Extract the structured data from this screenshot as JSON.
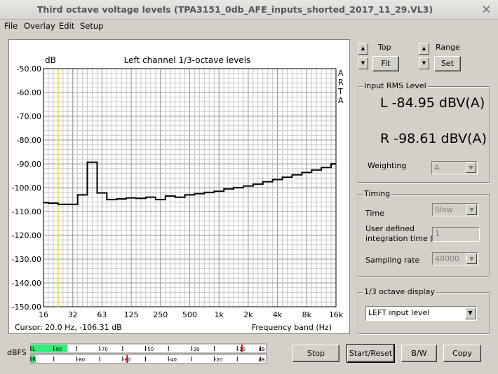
{
  "window": {
    "title": "Third octave voltage levels (TPA3151_0db_AFE_inputs_shorted_2017_11_29.VL3)",
    "close_glyph": "✕"
  },
  "menu": [
    "File",
    "Overlay",
    "Edit",
    "Setup"
  ],
  "chart_data": {
    "type": "line",
    "title": "Left channel 1/3-octave levels",
    "ylabel": "dB",
    "xlabel": "Frequency band (Hz)",
    "side_label": [
      "A",
      "R",
      "T",
      "A"
    ],
    "ylim": [
      -150,
      -50
    ],
    "y_ticks": [
      "-50.00",
      "-60.00",
      "-70.00",
      "-80.00",
      "-90.00",
      "-100.00",
      "-110.00",
      "-120.00",
      "-130.00",
      "-140.00",
      "-150.00"
    ],
    "x_ticks": [
      "16",
      "32",
      "63",
      "125",
      "250",
      "500",
      "1k",
      "2k",
      "4k",
      "8k",
      "16k"
    ],
    "cursor_text": "Cursor:   20.0 Hz, -106.31 dB",
    "series": [
      {
        "color": "#000000",
        "bands": [
          "16",
          "20",
          "25",
          "31.5",
          "40",
          "50",
          "63",
          "80",
          "100",
          "125",
          "160",
          "200",
          "250",
          "315",
          "400",
          "500",
          "630",
          "800",
          "1k",
          "1.25k",
          "1.6k",
          "2k",
          "2.5k",
          "3.15k",
          "4k",
          "5k",
          "6.3k",
          "8k",
          "10k",
          "12.5k",
          "16k"
        ],
        "values": [
          -106.3,
          -106.5,
          -107,
          -107,
          -103,
          -89.3,
          -102.2,
          -105,
          -104.7,
          -104.3,
          -104.5,
          -104,
          -105,
          -103.5,
          -104,
          -103,
          -102.5,
          -102,
          -101.5,
          -100.5,
          -100,
          -99.3,
          -98.5,
          -97.5,
          -96.6,
          -95.6,
          -94.6,
          -93.6,
          -92.6,
          -91.5,
          -90
        ]
      }
    ],
    "cursor_band": "20",
    "cursor_color": "#e6e600"
  },
  "controls": {
    "top_label": "Top",
    "fit_label": "Fit",
    "range_label": "Range",
    "set_label": "Set",
    "up_glyph": "▲",
    "down_glyph": "▼"
  },
  "rms": {
    "group_label": "Input RMS Level",
    "left": "L  -84.95 dBV(A)",
    "right": "R  -98.61 dBV(A)",
    "weighting_label": "Weighting",
    "weighting_value": "A"
  },
  "timing": {
    "group_label": "Timing",
    "time_label": "Time",
    "time_value": "Slow",
    "user_time_label_1": "User defined",
    "user_time_label_2": "integration time (s)",
    "user_time_value": "1",
    "sampling_label": "Sampling rate",
    "sampling_value": "48000"
  },
  "display": {
    "group_label": "1/3 octave display",
    "selected": "LEFT input level"
  },
  "meter": {
    "label": "dBFS",
    "top_channel": "L",
    "bottom_channel": "R",
    "top_scale": [
      "-90",
      "-70",
      "-50",
      "-30",
      "-10",
      "dB"
    ],
    "bottom_scale": [
      "-80",
      "-60",
      "-40",
      "-20",
      "dB"
    ],
    "left_level_dbfs": -84,
    "left_peak_dbfs": -8,
    "right_level_dbfs": -98,
    "right_peak_dbfs": -58,
    "fill_color": "#33ee77",
    "peak_color": "#dd0000"
  },
  "buttons": {
    "stop": "Stop",
    "start_reset": "Start/Reset",
    "bw": "B/W",
    "copy": "Copy"
  }
}
